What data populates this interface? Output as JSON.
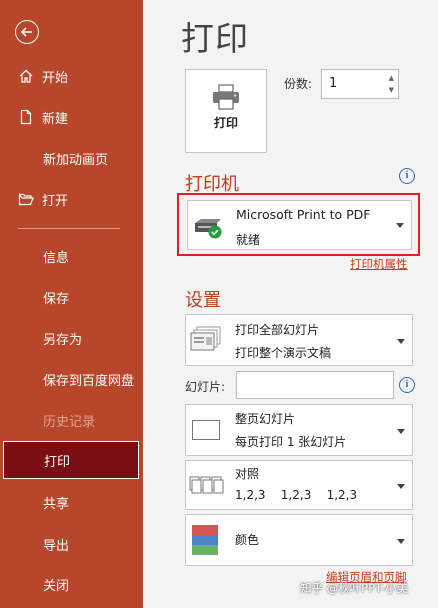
{
  "sidebar": {
    "items": [
      {
        "label": "开始"
      },
      {
        "label": "新建"
      },
      {
        "label": "新加动画页"
      },
      {
        "label": "打开"
      },
      {
        "label": "信息"
      },
      {
        "label": "保存"
      },
      {
        "label": "另存为"
      },
      {
        "label": "保存到百度网盘"
      },
      {
        "label": "历史记录"
      },
      {
        "label": "打印"
      },
      {
        "label": "共享"
      },
      {
        "label": "导出"
      },
      {
        "label": "关闭"
      }
    ]
  },
  "main": {
    "title": "打印",
    "print_button": "打印",
    "copies_label": "份数:",
    "copies_value": "1",
    "printer_section": "打印机",
    "printer": {
      "name": "Microsoft Print to PDF",
      "status": "就绪"
    },
    "printer_properties_link": "打印机属性",
    "settings_section": "设置",
    "settings": {
      "range": {
        "line1": "打印全部幻灯片",
        "line2": "打印整个演示文稿"
      },
      "slides_label": "幻灯片:",
      "slides_value": "",
      "layout": {
        "line1": "整页幻灯片",
        "line2": "每页打印 1 张幻灯片"
      },
      "collate": {
        "line1": "对照",
        "line2": "1,2,3    1,2,3    1,2,3"
      },
      "color": {
        "line1": "颜色"
      }
    },
    "header_footer_link": "编辑页眉和页脚"
  },
  "watermark": "知乎 @秋叶PPT-小美",
  "colors": {
    "sidebar": "#b7472a",
    "active": "#7b0e12",
    "accent": "#c43e1c",
    "highlight": "#e0201d",
    "info": "#2b6cc4"
  }
}
